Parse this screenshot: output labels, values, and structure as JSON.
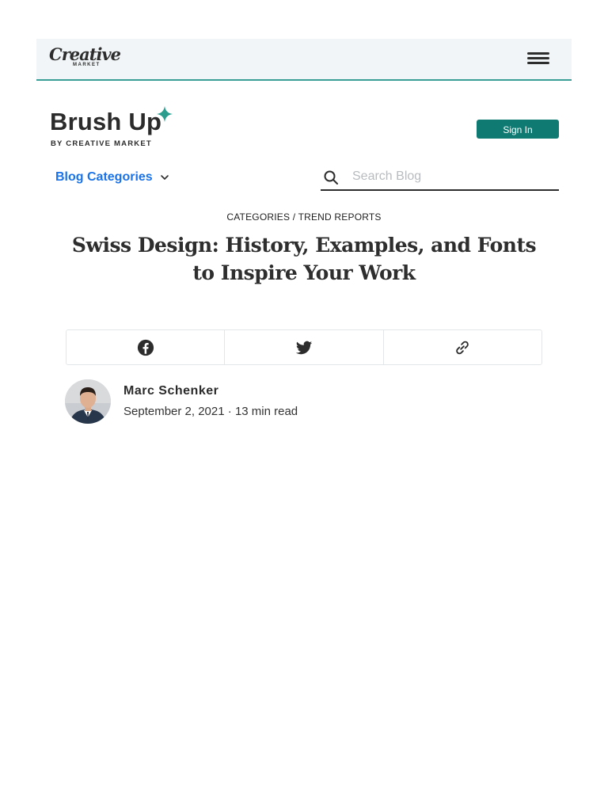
{
  "header": {
    "logo_word": "Creative",
    "logo_sub": "MARKET",
    "menu_icon": "hamburger-menu-icon"
  },
  "brand": {
    "title": "Brush Up",
    "subtitle": "BY CREATIVE MARKET",
    "sparkle_icon": "sparkle-icon",
    "accent_color": "#2a9d8f"
  },
  "auth": {
    "sign_in_label": "Sign In",
    "button_color": "#0f7a72"
  },
  "nav": {
    "blog_categories_label": "Blog Categories",
    "link_color": "#1a73e8"
  },
  "search": {
    "placeholder": "Search Blog",
    "value": ""
  },
  "article": {
    "breadcrumb_category": "CATEGORIES",
    "breadcrumb_separator": " / ",
    "breadcrumb_subcategory": "TREND REPORTS",
    "title": "Swiss Design: History, Examples, and Fonts to Inspire Your Work"
  },
  "share": {
    "icons": [
      "facebook-icon",
      "twitter-icon",
      "link-icon"
    ]
  },
  "author": {
    "name": "Marc Schenker",
    "date": "September 2, 2021",
    "separator": " · ",
    "read_time": "13 min read"
  }
}
